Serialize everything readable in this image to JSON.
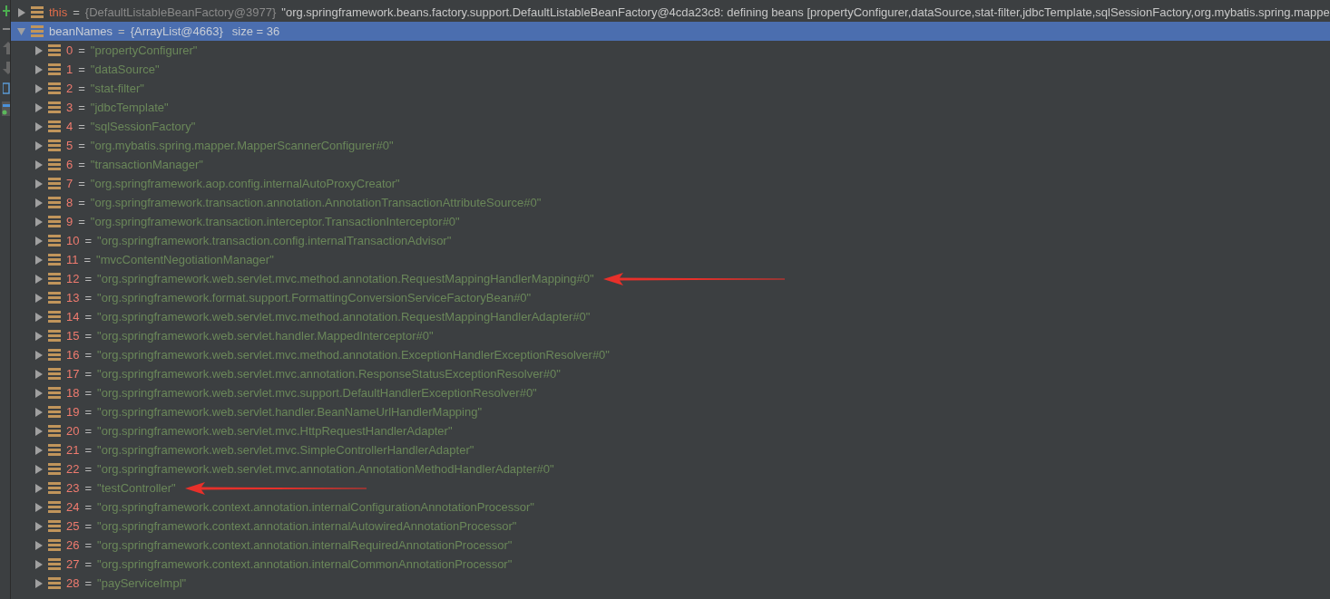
{
  "variables": [
    {
      "name": "this",
      "eq": "=",
      "type_ref": "{DefaultListableBeanFactory@3977}",
      "value": "\"org.springframework.beans.factory.support.DefaultListableBeanFactory@4cda23c8: defining beans [propertyConfigurer,dataSource,stat-filter,jdbcTemplate,sqlSessionFactory,org.mybatis.spring.mappe",
      "expanded": false,
      "selected": false
    },
    {
      "name": "beanNames",
      "eq": "=",
      "type_ref": "{ArrayList@4663}",
      "value": "size = 36",
      "expanded": true,
      "selected": true,
      "children": [
        {
          "name": "0",
          "eq": "=",
          "value": "\"propertyConfigurer\"",
          "expanded": false,
          "marked": false
        },
        {
          "name": "1",
          "eq": "=",
          "value": "\"dataSource\"",
          "expanded": false,
          "marked": false
        },
        {
          "name": "2",
          "eq": "=",
          "value": "\"stat-filter\"",
          "expanded": false,
          "marked": false
        },
        {
          "name": "3",
          "eq": "=",
          "value": "\"jdbcTemplate\"",
          "expanded": false,
          "marked": false
        },
        {
          "name": "4",
          "eq": "=",
          "value": "\"sqlSessionFactory\"",
          "expanded": false,
          "marked": false
        },
        {
          "name": "5",
          "eq": "=",
          "value": "\"org.mybatis.spring.mapper.MapperScannerConfigurer#0\"",
          "expanded": false,
          "marked": false
        },
        {
          "name": "6",
          "eq": "=",
          "value": "\"transactionManager\"",
          "expanded": false,
          "marked": false
        },
        {
          "name": "7",
          "eq": "=",
          "value": "\"org.springframework.aop.config.internalAutoProxyCreator\"",
          "expanded": false,
          "marked": false
        },
        {
          "name": "8",
          "eq": "=",
          "value": "\"org.springframework.transaction.annotation.AnnotationTransactionAttributeSource#0\"",
          "expanded": false,
          "marked": false
        },
        {
          "name": "9",
          "eq": "=",
          "value": "\"org.springframework.transaction.interceptor.TransactionInterceptor#0\"",
          "expanded": false,
          "marked": false
        },
        {
          "name": "10",
          "eq": "=",
          "value": "\"org.springframework.transaction.config.internalTransactionAdvisor\"",
          "expanded": false,
          "marked": false
        },
        {
          "name": "11",
          "eq": "=",
          "value": "\"mvcContentNegotiationManager\"",
          "expanded": false,
          "marked": false
        },
        {
          "name": "12",
          "eq": "=",
          "value": "\"org.springframework.web.servlet.mvc.method.annotation.RequestMappingHandlerMapping#0\"",
          "expanded": false,
          "marked": true
        },
        {
          "name": "13",
          "eq": "=",
          "value": "\"org.springframework.format.support.FormattingConversionServiceFactoryBean#0\"",
          "expanded": false,
          "marked": false
        },
        {
          "name": "14",
          "eq": "=",
          "value": "\"org.springframework.web.servlet.mvc.method.annotation.RequestMappingHandlerAdapter#0\"",
          "expanded": false,
          "marked": false
        },
        {
          "name": "15",
          "eq": "=",
          "value": "\"org.springframework.web.servlet.handler.MappedInterceptor#0\"",
          "expanded": false,
          "marked": false
        },
        {
          "name": "16",
          "eq": "=",
          "value": "\"org.springframework.web.servlet.mvc.method.annotation.ExceptionHandlerExceptionResolver#0\"",
          "expanded": false,
          "marked": false
        },
        {
          "name": "17",
          "eq": "=",
          "value": "\"org.springframework.web.servlet.mvc.annotation.ResponseStatusExceptionResolver#0\"",
          "expanded": false,
          "marked": false
        },
        {
          "name": "18",
          "eq": "=",
          "value": "\"org.springframework.web.servlet.mvc.support.DefaultHandlerExceptionResolver#0\"",
          "expanded": false,
          "marked": false
        },
        {
          "name": "19",
          "eq": "=",
          "value": "\"org.springframework.web.servlet.handler.BeanNameUrlHandlerMapping\"",
          "expanded": false,
          "marked": false
        },
        {
          "name": "20",
          "eq": "=",
          "value": "\"org.springframework.web.servlet.mvc.HttpRequestHandlerAdapter\"",
          "expanded": false,
          "marked": false
        },
        {
          "name": "21",
          "eq": "=",
          "value": "\"org.springframework.web.servlet.mvc.SimpleControllerHandlerAdapter\"",
          "expanded": false,
          "marked": false
        },
        {
          "name": "22",
          "eq": "=",
          "value": "\"org.springframework.web.servlet.mvc.annotation.AnnotationMethodHandlerAdapter#0\"",
          "expanded": false,
          "marked": false
        },
        {
          "name": "23",
          "eq": "=",
          "value": "\"testController\"",
          "expanded": false,
          "marked": true
        },
        {
          "name": "24",
          "eq": "=",
          "value": "\"org.springframework.context.annotation.internalConfigurationAnnotationProcessor\"",
          "expanded": false,
          "marked": false
        },
        {
          "name": "25",
          "eq": "=",
          "value": "\"org.springframework.context.annotation.internalAutowiredAnnotationProcessor\"",
          "expanded": false,
          "marked": false
        },
        {
          "name": "26",
          "eq": "=",
          "value": "\"org.springframework.context.annotation.internalRequiredAnnotationProcessor\"",
          "expanded": false,
          "marked": false
        },
        {
          "name": "27",
          "eq": "=",
          "value": "\"org.springframework.context.annotation.internalCommonAnnotationProcessor\"",
          "expanded": false,
          "marked": false
        },
        {
          "name": "28",
          "eq": "=",
          "value": "\"payServiceImpl\"",
          "expanded": false,
          "marked": false
        }
      ]
    }
  ]
}
